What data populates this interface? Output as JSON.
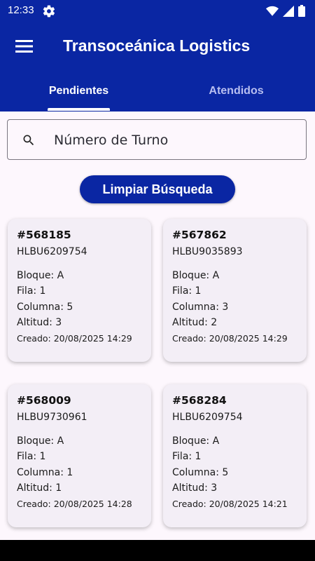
{
  "status_bar": {
    "time": "12:33",
    "icons": [
      "gear-icon",
      "wifi-icon",
      "signal-icon",
      "battery-icon"
    ]
  },
  "app_bar": {
    "title": "Transoceánica Logistics",
    "menu_icon": "hamburger-menu-icon"
  },
  "tabs": [
    {
      "label": "Pendientes",
      "active": true
    },
    {
      "label": "Atendidos",
      "active": false
    }
  ],
  "search": {
    "placeholder": "Número de Turno",
    "value": ""
  },
  "clear_button": {
    "label": "Limpiar Búsqueda"
  },
  "cards": [
    {
      "id": "#568185",
      "code": "HLBU6209754",
      "bloque": "Bloque: A",
      "fila": "Fila: 1",
      "columna": "Columna: 5",
      "altitud": "Altitud: 3",
      "creado": "Creado: 20/08/2025 14:29"
    },
    {
      "id": "#567862",
      "code": "HLBU9035893",
      "bloque": "Bloque: A",
      "fila": "Fila: 1",
      "columna": "Columna: 3",
      "altitud": "Altitud: 2",
      "creado": "Creado: 20/08/2025 14:29"
    },
    {
      "id": "#568009",
      "code": "HLBU9730961",
      "bloque": "Bloque: A",
      "fila": "Fila: 1",
      "columna": "Columna: 1",
      "altitud": "Altitud: 1",
      "creado": "Creado: 20/08/2025 14:28"
    },
    {
      "id": "#568284",
      "code": "HLBU6209754",
      "bloque": "Bloque: A",
      "fila": "Fila: 1",
      "columna": "Columna: 5",
      "altitud": "Altitud: 3",
      "creado": "Creado: 20/08/2025 14:21"
    }
  ],
  "colors": {
    "primary": "#0a26a3",
    "background": "#fdf7fd",
    "card": "#f3eef6"
  }
}
